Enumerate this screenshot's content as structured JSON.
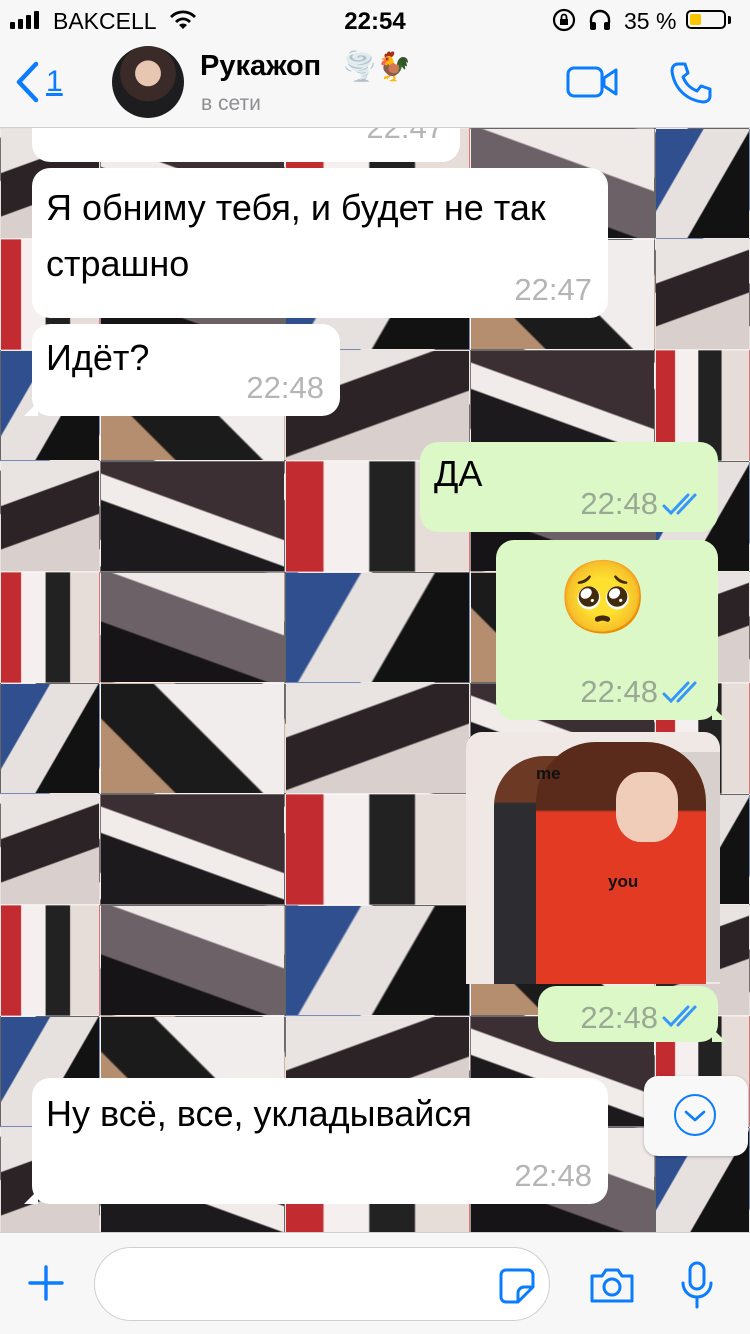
{
  "status_bar": {
    "carrier": "BAKCELL",
    "time": "22:54",
    "battery_percent": "35 %",
    "battery_level": 0.35,
    "battery_color": "#f7c600"
  },
  "header": {
    "back_count": "1",
    "contact_name": "Рукажоп",
    "contact_emoji": "🌪️🐓",
    "contact_status": "в сети",
    "accent_color": "#0a7cff",
    "icons": [
      "chevron-left-icon",
      "video-camera-icon",
      "phone-icon"
    ]
  },
  "messages": [
    {
      "direction": "in",
      "text": "Я обниму тебя, и будет не так страшно",
      "time": "22:47"
    },
    {
      "direction": "in",
      "text": "Идёт?",
      "time": "22:48"
    },
    {
      "direction": "out",
      "text": "ДА",
      "time": "22:48",
      "status": "read"
    },
    {
      "direction": "out",
      "text": "🥺",
      "time": "22:48",
      "status": "read"
    },
    {
      "direction": "out",
      "type": "photo",
      "caption_labels": [
        "me",
        "you"
      ],
      "time": "22:48",
      "status": "read"
    },
    {
      "direction": "in",
      "text": "Ну всё, все, укладывайся",
      "time": "22:48"
    }
  ],
  "partial_top_message_time": "22:47",
  "input_bar": {
    "placeholder": "",
    "icons": [
      "plus-icon",
      "sticker-icon",
      "camera-icon",
      "microphone-icon"
    ]
  },
  "colors": {
    "outgoing_bubble": "#dcf8c6",
    "incoming_bubble": "#ffffff",
    "read_ticks": "#3497f9"
  }
}
